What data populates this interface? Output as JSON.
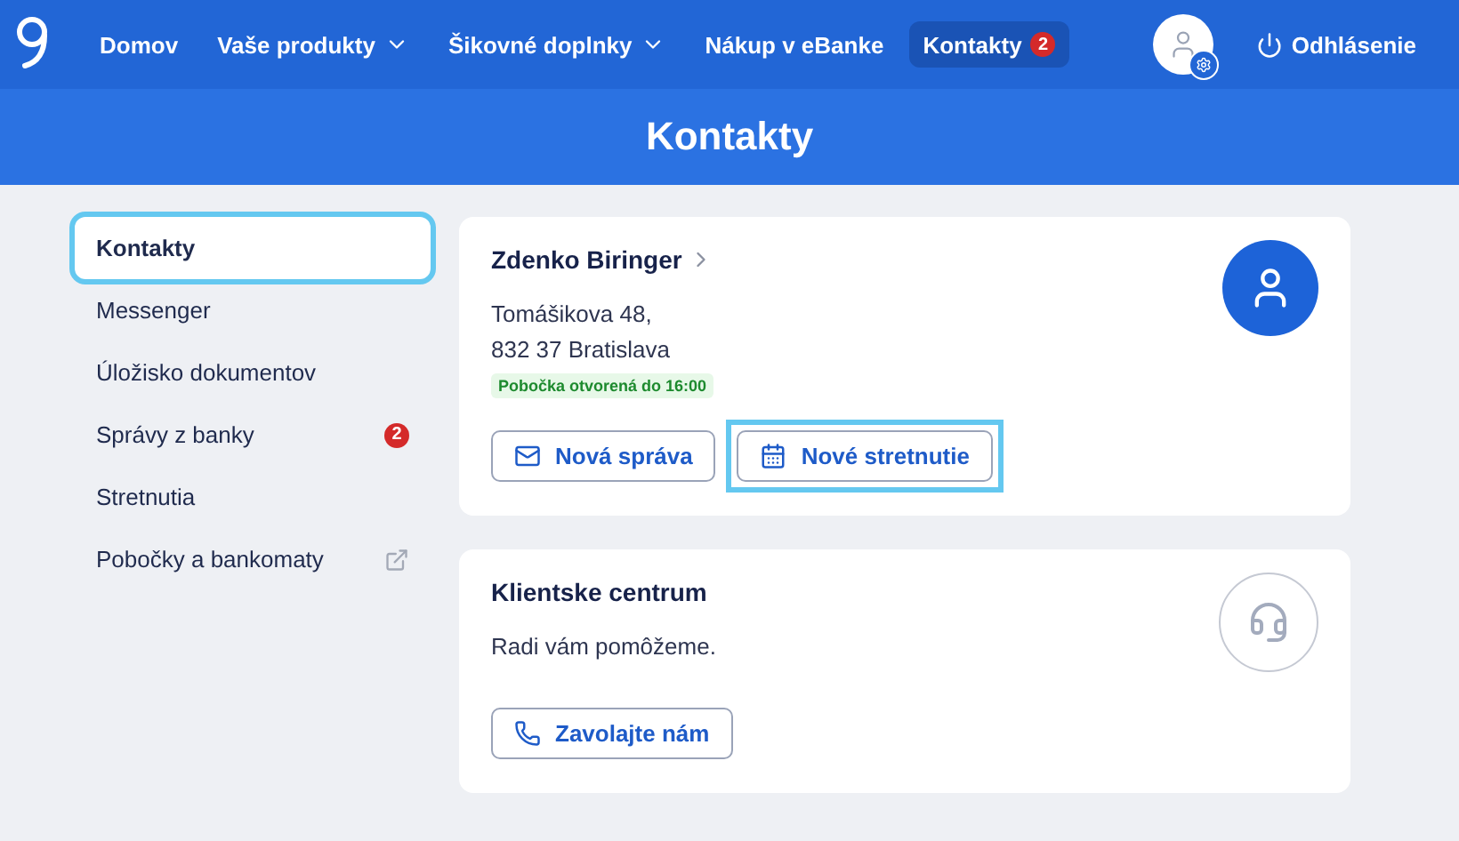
{
  "nav": {
    "items": [
      {
        "label": "Domov",
        "dropdown": false,
        "selected": false
      },
      {
        "label": "Vaše produkty",
        "dropdown": true,
        "selected": false
      },
      {
        "label": "Šikovné doplnky",
        "dropdown": true,
        "selected": false
      },
      {
        "label": "Nákup v eBanke",
        "dropdown": false,
        "selected": false
      },
      {
        "label": "Kontakty",
        "dropdown": false,
        "selected": true,
        "badge": "2"
      }
    ],
    "logout": "Odhlásenie"
  },
  "page_title": "Kontakty",
  "sidebar": {
    "items": [
      {
        "label": "Kontakty",
        "selected": true,
        "highlighted": true
      },
      {
        "label": "Messenger",
        "selected": false,
        "highlighted": false
      },
      {
        "label": "Úložisko dokumentov",
        "selected": false,
        "highlighted": false
      },
      {
        "label": "Správy z banky",
        "selected": false,
        "highlighted": false,
        "badge": "2"
      },
      {
        "label": "Stretnutia",
        "selected": false,
        "highlighted": false
      },
      {
        "label": "Pobočky a bankomaty",
        "selected": false,
        "highlighted": false,
        "external": true
      }
    ]
  },
  "cards": [
    {
      "kind": "advisor",
      "title": "Zdenko Biringer",
      "address": [
        "Tomášikova 48,",
        "832 37 Bratislava"
      ],
      "status": "Pobočka otvorená do 16:00",
      "buttons": [
        {
          "kind": "mail",
          "label": "Nová správa",
          "highlighted": false
        },
        {
          "kind": "calendar",
          "label": "Nové stretnutie",
          "highlighted": true
        }
      ]
    },
    {
      "kind": "center",
      "title": "Klientske centrum",
      "text": "Radi vám pomôžeme.",
      "buttons": [
        {
          "kind": "phone",
          "label": "Zavolajte nám",
          "highlighted": false
        }
      ]
    }
  ]
}
